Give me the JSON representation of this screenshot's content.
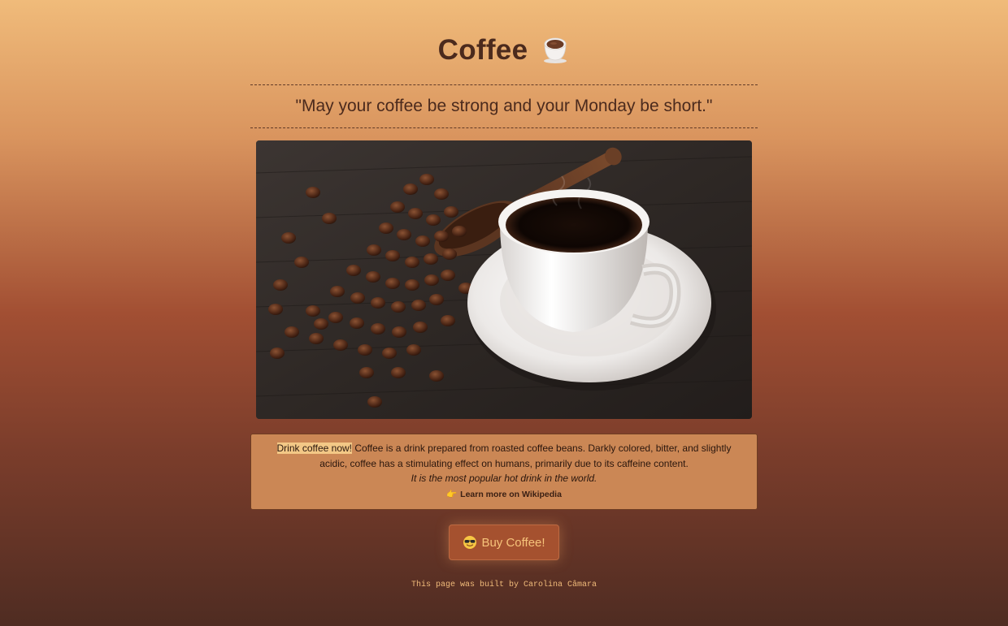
{
  "header": {
    "title": "Coffee",
    "title_icon": "coffee-cup-icon",
    "quote": "\"May your coffee be strong and your Monday be short.\""
  },
  "hero_image": {
    "description_icon": "coffee-cup-and-beans-photo"
  },
  "info": {
    "highlight": "Drink coffee now!",
    "body": " Coffee is a drink prepared from roasted coffee beans. Darkly colored, bitter, and slightly acidic, coffee has a stimulating effect on humans, primarily due to its caffeine content.",
    "italic": "It is the most popular hot drink in the world.",
    "link_icon": "pointing-hand-icon",
    "link_label": "Learn more on Wikipedia"
  },
  "cta": {
    "icon": "sunglasses-face-icon",
    "label": "Buy Coffee!"
  },
  "footer": {
    "text": "This page was built by Carolina Câmara"
  },
  "colors": {
    "bg_top": "#f0bb7a",
    "bg_mid": "#a24f33",
    "bg_bottom": "#4f2c22",
    "text_dark": "#4b2a1d",
    "info_bg": "#cb8755",
    "highlight": "#f3c886",
    "button_bg": "#a5512f",
    "button_text": "#f6c37a"
  }
}
